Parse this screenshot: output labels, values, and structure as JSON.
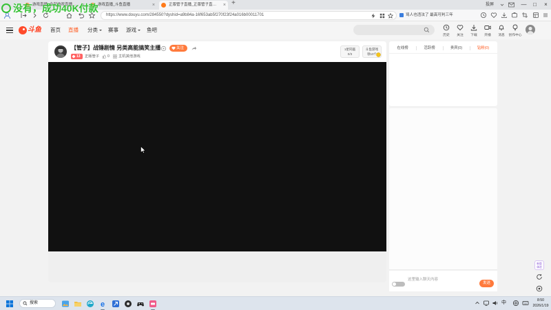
{
  "watermark": "没有，成功40K付款",
  "browser": {
    "tabs": [
      {
        "label": "游戏直播_全部游戏直播_斗鱼直播"
      },
      {
        "label": "游戏直播_斗鱼直播"
      },
      {
        "label": "正版管子直播_正版管子直播_正版管子"
      }
    ],
    "new_tab": "+",
    "cast_label": "投屏",
    "url": "https://www.douyu.com/284550?dyshid=a9b84a-16f653ab5f270f23f24a016b00011701",
    "search_suggestion": "骂人也违法了 最高可判三年",
    "window_controls": {
      "minimize": "—",
      "maximize": "□",
      "close": "×"
    }
  },
  "site": {
    "logo": "斗鱼",
    "accent": "#ff5d23",
    "nav": [
      {
        "label": "首页"
      },
      {
        "label": "直播",
        "active": true
      },
      {
        "label": "分类",
        "dropdown": true
      },
      {
        "label": "赛事"
      },
      {
        "label": "游戏",
        "dropdown": true
      },
      {
        "label": "鱼吧"
      }
    ],
    "header_actions": [
      {
        "label": "历史",
        "icon": "clock-icon"
      },
      {
        "label": "关注",
        "icon": "heart-icon"
      },
      {
        "label": "下载",
        "icon": "download-icon"
      },
      {
        "label": "开播",
        "icon": "camera-icon"
      },
      {
        "label": "消息",
        "icon": "bell-icon"
      },
      {
        "label": "创作中心",
        "icon": "bulb-icon"
      }
    ]
  },
  "room": {
    "title": "【管子】战锤剧情 另类高能搞笑主播",
    "follow_label": "关注",
    "level": "13",
    "streamer": "正版管子",
    "likes": "0",
    "category": "主机其他游戏",
    "tasks": [
      {
        "line1": "1星同画",
        "line2": "0/3"
      },
      {
        "line1": "斗鱼游戏",
        "line2": "领10个"
      }
    ]
  },
  "side": {
    "rank_tabs": [
      "在线榜",
      "活跃榜",
      "贵宾(0)",
      "钻粉(0)"
    ],
    "chat_placeholder": "这里输入聊天内容",
    "send_label": "发送",
    "beta_badge": [
      "新版",
      "体验"
    ]
  },
  "taskbar": {
    "search_label": "搜索",
    "apps": [
      "photos-icon",
      "file-explorer-icon",
      "edge-icon",
      "ie-icon",
      "blue-app-icon",
      "dark-app-icon",
      "controller-app-icon",
      "pink-app-icon"
    ],
    "ime": "中",
    "time": "8:50",
    "date": "2026/1/19"
  }
}
